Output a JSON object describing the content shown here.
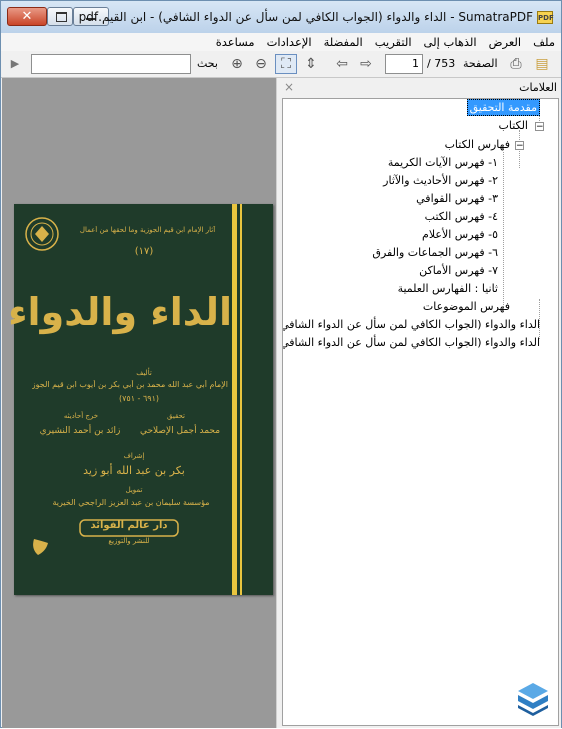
{
  "window": {
    "title": "SumatraPDF - الداء والدواء (الجواب الكافي لمن سأل عن الدواء الشافي) - ابن القيم.pdf",
    "app_icon_text": "PDF"
  },
  "menu": [
    "ملف",
    "العرض",
    "الذهاب إلى",
    "التقريب",
    "المفضلة",
    "الإعدادات",
    "مساعدة"
  ],
  "toolbar": {
    "page_label": "الصفحة",
    "page_value": "1",
    "page_total": "/ 753",
    "search_label": "بحث",
    "search_placeholder": ""
  },
  "sidebar": {
    "title": "العلامات",
    "close": "×",
    "bookmarks": [
      "مقدمة التحقيق",
      "الكتاب",
      "فهارس الكتاب",
      "١- فهرس الآيات الكريمة",
      "٢- فهرس الأحاديث والآثار",
      "٣- فهرس القوافي",
      "٤- فهرس الكتب",
      "٥- فهرس الأعلام",
      "٦- فهرس الجماعات والفرق",
      "٧- فهرس الأماكن",
      "ثانيا : الفهارس العلمية",
      "فهرس الموضوعات",
      "الداء والدواء (الجواب الكافي لمن سأل عن الدواء الشافي)",
      "الداء والدواء (الجواب الكافي لمن سأل عن الدواء الشافي)"
    ]
  },
  "cover": {
    "series": "آثار الإمام ابن قيم الجوزية وما لحقها من أعمال",
    "number": "(١٧)",
    "title": "الداء والدواء",
    "author_label": "تأليف",
    "author": "الإمام أبي عبد الله محمد بن أبي بكر بن أيوب ابن قيم الجوزية",
    "dates": "(٦٩١ - ٧٥١)",
    "editor_label": "تحقيق",
    "editor": "محمد أجمل الإصلاحي",
    "hadith_label": "خرج أحاديثه",
    "hadith": "زائد بن أحمد النشيري",
    "supervisor_label": "إشراف",
    "supervisor": "بكر بن عبد الله أبو زيد",
    "funding_label": "تمويل",
    "funding": "مؤسسة سليمان بن عبد العزيز الراجحي الخيرية",
    "publisher": "دار عالم الفوائد",
    "publisher_sub": "للنشر والتوزيع",
    "colors": {
      "cloth": "#1f3b2a",
      "gold": "#d8b24a",
      "stripe": "#e9c53f"
    }
  }
}
